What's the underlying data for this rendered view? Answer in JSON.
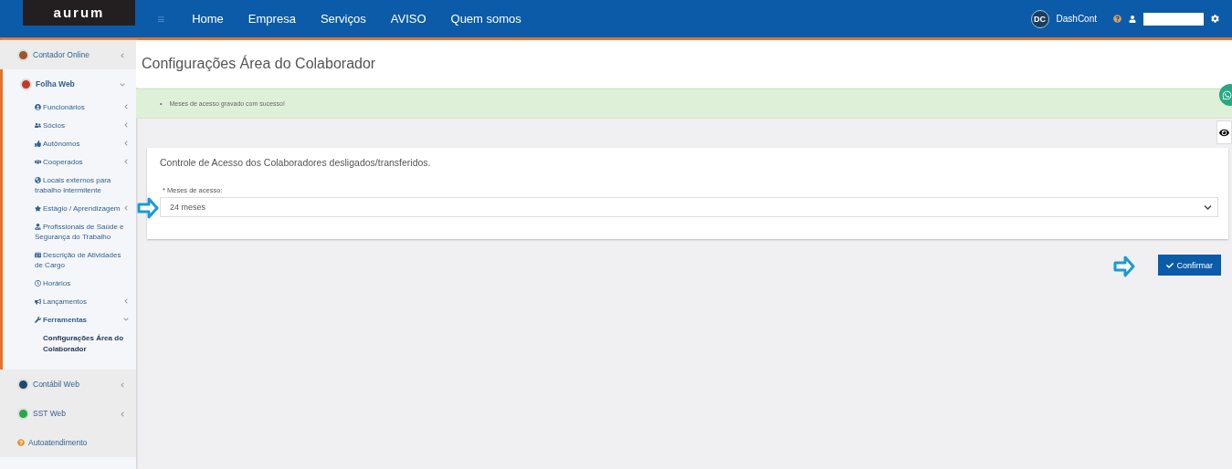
{
  "header": {
    "logo": "aurum",
    "menu_icon": "≡",
    "nav": [
      {
        "label": "Home"
      },
      {
        "label": "Empresa"
      },
      {
        "label": "Serviços"
      },
      {
        "label": "AVISO"
      },
      {
        "label": "Quem somos"
      }
    ],
    "dashcont_logo": "DC",
    "dashcont": "DashCont"
  },
  "sidebar": {
    "items": [
      {
        "label": "Contador Online",
        "kind": "module",
        "expanded": false,
        "selected": false
      },
      {
        "label": "Folha Web",
        "kind": "module",
        "expanded": true,
        "selected": false,
        "children": [
          {
            "label": "Funcionários",
            "expanded": false,
            "selected": false
          },
          {
            "label": "Sócios",
            "expanded": false,
            "selected": false
          },
          {
            "label": "Autônomos",
            "expanded": false,
            "selected": false
          },
          {
            "label": "Cooperados",
            "expanded": false,
            "selected": false
          },
          {
            "label": "Locais externos para trabalho intermitente",
            "selected": false
          },
          {
            "label": "Estágio / Aprendizagem",
            "expanded": false,
            "selected": false
          },
          {
            "label": "Profissionais de Saúde e Segurança do Trabalho",
            "selected": false
          },
          {
            "label": "Descrição de Atividades de Cargo",
            "selected": false
          },
          {
            "label": "Horários",
            "selected": false
          },
          {
            "label": "Lançamentos",
            "expanded": false,
            "selected": false
          },
          {
            "label": "Ferramentas",
            "expanded": true,
            "selected": false,
            "children": [
              {
                "label": "Configurações Área do Colaborador",
                "selected": true
              }
            ]
          }
        ]
      },
      {
        "label": "Contábil Web",
        "kind": "module",
        "expanded": false,
        "selected": false
      },
      {
        "label": "SST Web",
        "kind": "module",
        "expanded": false,
        "selected": false
      },
      {
        "label": "Autoatendimento",
        "kind": "help",
        "selected": false
      }
    ]
  },
  "page": {
    "title": "Configurações Área do Colaborador",
    "alert": {
      "messages": [
        {
          "bullet": "•",
          "text": "Meses de acesso gravado com sucesso!"
        }
      ]
    },
    "card": {
      "title": "Controle de Acesso dos Colaboradores desligados/transferidos.",
      "field": {
        "label": "* Meses de acesso:",
        "value": "24 meses"
      }
    },
    "confirm_button": "Confirmar"
  }
}
